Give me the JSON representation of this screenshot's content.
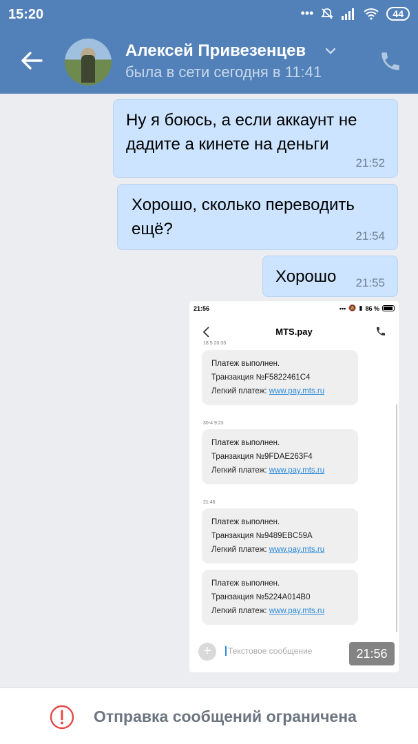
{
  "status_bar": {
    "time": "15:20",
    "battery": "44",
    "icons": [
      "dots-icon",
      "muted-bell-icon",
      "signal-icon",
      "wifi-icon"
    ]
  },
  "header": {
    "contact_name": "Алексей Привезенцев",
    "contact_status": "была в сети сегодня в 11:41",
    "accent_color": "#5181b8"
  },
  "messages": [
    {
      "text": "Ну я боюсь, а если аккаунт не дадите а кинете на деньги",
      "time": "21:52"
    },
    {
      "text": "Хорошо, сколько переводить ещё?",
      "time": "21:54"
    },
    {
      "text": "Хорошо",
      "time": "21:55"
    }
  ],
  "attachment": {
    "time": "21:56",
    "screenshot": {
      "status_time": "21:56",
      "status_battery": "86 %",
      "title": "MTS.pay",
      "cut_date": "18.5 20:33",
      "sms": [
        {
          "line1": "Платеж выполнен.",
          "line2": "Транзакция №F5822461C4",
          "line3_prefix": "Легкий платеж: ",
          "link": "www.pay.mts.ru",
          "date": ""
        },
        {
          "line1": "Платеж выполнен.",
          "line2": "Транзакция №9FDAE263F4",
          "line3_prefix": "Легкий платеж: ",
          "link": "www.pay.mts.ru",
          "date": "30-4 9:23"
        },
        {
          "line1": "Платеж выполнен.",
          "line2": "Транзакция №9489EBC59A",
          "line3_prefix": "Легкий платеж: ",
          "link": "www.pay.mts.ru",
          "date": "21:46"
        },
        {
          "line1": "Платеж выполнен.",
          "line2": "Транзакция №5224A014B0",
          "line3_prefix": "Легкий платеж: ",
          "link": "www.pay.mts.ru",
          "date": ""
        }
      ],
      "input_placeholder": "Текстовое сообщение"
    }
  },
  "bottom": {
    "notice": "Отправка сообщений ограничена"
  }
}
